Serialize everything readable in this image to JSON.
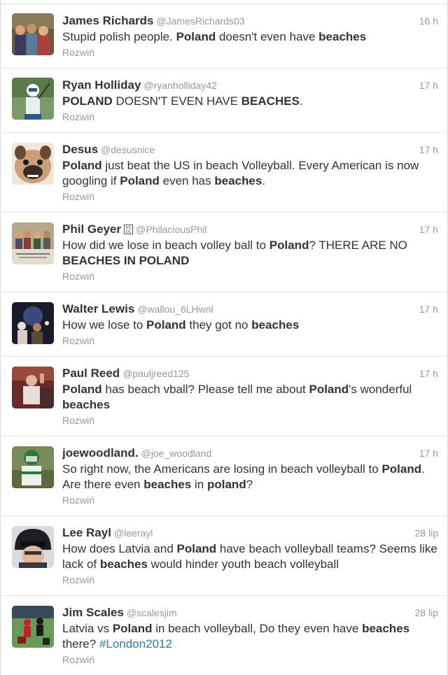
{
  "tweets": [
    {
      "name": "James Richards",
      "handle": "@JamesRichards03",
      "time": "16 h",
      "text": [
        [
          "Stupid polish people. ",
          false
        ],
        [
          "Poland",
          true
        ],
        [
          " doesn't even have ",
          false
        ],
        [
          "beaches",
          true
        ]
      ],
      "expand": "Rozwiń",
      "avatar": "group-photo"
    },
    {
      "name": "Ryan Holliday",
      "handle": "@ryanholliday42",
      "time": "17 h",
      "text": [
        [
          "POLAND",
          true
        ],
        [
          " DOESN'T EVEN HAVE ",
          false
        ],
        [
          "BEACHES",
          true
        ],
        [
          ".",
          false
        ]
      ],
      "expand": "Rozwiń",
      "avatar": "lacrosse-player"
    },
    {
      "name": "Desus",
      "handle": "@desusnice",
      "time": "17 h",
      "text": [
        [
          "Poland",
          true
        ],
        [
          " just beat the US in beach Volleyball. Every American is now googling if ",
          false
        ],
        [
          "Poland",
          true
        ],
        [
          " even has ",
          false
        ],
        [
          "beaches",
          true
        ],
        [
          ".",
          false
        ]
      ],
      "expand": "Rozwiń",
      "avatar": "bulldog"
    },
    {
      "name": "Phil Geyer",
      "handle": "@PhilaciousPhil",
      "time": "17 h",
      "text": [
        [
          "How did we lose in beach volley ball to ",
          false
        ],
        [
          "Poland",
          true
        ],
        [
          "? THERE ARE NO ",
          false
        ],
        [
          "BEACHES IN POLAND",
          true
        ]
      ],
      "expand": "Rozwiń",
      "avatar": "band-photo",
      "has_badge": true
    },
    {
      "name": "Walter Lewis",
      "handle": "@wallou_6LHwnl",
      "time": "17 h",
      "text": [
        [
          "How we lose to ",
          false
        ],
        [
          "Poland",
          true
        ],
        [
          " they got no ",
          false
        ],
        [
          "beaches",
          true
        ]
      ],
      "expand": "Rozwiń",
      "avatar": "night-photo"
    },
    {
      "name": "Paul Reed",
      "handle": "@pauljreed125",
      "time": "17 h",
      "text": [
        [
          "Poland",
          true
        ],
        [
          " has beach vball? Please tell me about ",
          false
        ],
        [
          "Poland",
          true
        ],
        [
          "'s wonderful ",
          false
        ],
        [
          "beaches",
          true
        ]
      ],
      "expand": "Rozwiń",
      "avatar": "party-photo"
    },
    {
      "name": "joewoodland.",
      "handle": "@joe_woodland",
      "time": "17 h",
      "text": [
        [
          "So right now, the Americans are losing in beach volleyball to ",
          false
        ],
        [
          "Poland",
          true
        ],
        [
          ". Are there even ",
          false
        ],
        [
          "beaches",
          true
        ],
        [
          " in ",
          false
        ],
        [
          "poland",
          true
        ],
        [
          "?",
          false
        ]
      ],
      "expand": "Rozwiń",
      "avatar": "helmet-player"
    },
    {
      "name": "Lee Rayl",
      "handle": "@leerayl",
      "time": "28 lip",
      "text": [
        [
          "How does Latvia and ",
          false
        ],
        [
          "Poland",
          true
        ],
        [
          " have beach volleyball teams? Seems like lack of ",
          false
        ],
        [
          "beaches",
          true
        ],
        [
          " would hinder youth beach volleyball",
          false
        ]
      ],
      "expand": "Rozwiń",
      "avatar": "welder-mask"
    },
    {
      "name": "Jim Scales",
      "handle": "@scalesjim",
      "time": "28 lip",
      "text": [
        [
          "Latvia vs ",
          false
        ],
        [
          "Poland",
          true
        ],
        [
          " in beach volleyball, Do they even have ",
          false
        ],
        [
          "beaches",
          true
        ],
        [
          " there? ",
          false
        ],
        [
          "#London2012",
          "hashtag"
        ]
      ],
      "expand": "Rozwiń",
      "avatar": "football-game"
    }
  ],
  "badge_text": "ES OC"
}
